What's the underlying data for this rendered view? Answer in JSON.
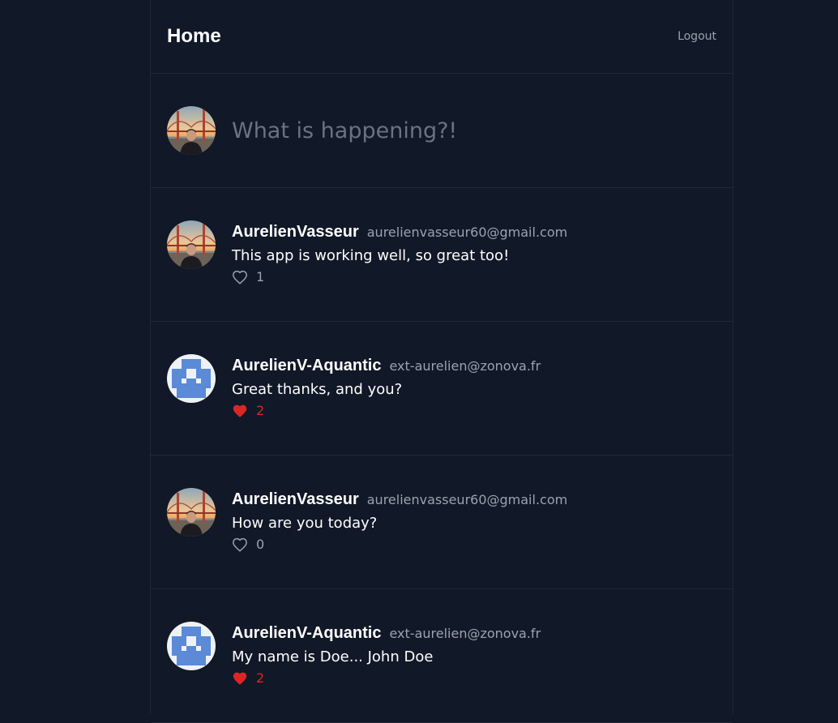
{
  "header": {
    "title": "Home",
    "logout_label": "Logout"
  },
  "compose": {
    "placeholder": "What is happening?!"
  },
  "colors": {
    "background": "#111827",
    "border": "#1f2937",
    "muted": "#9ca3af",
    "like_active": "#dc2626",
    "identicon": "#5b8ad6"
  },
  "posts": [
    {
      "username": "AurelienVasseur",
      "email": "aurelienvasseur60@gmail.com",
      "text": "This app is working well, so great too!",
      "likes": "1",
      "liked": false,
      "avatar": "photo"
    },
    {
      "username": "AurelienV-Aquantic",
      "email": "ext-aurelien@zonova.fr",
      "text": "Great thanks, and you?",
      "likes": "2",
      "liked": true,
      "avatar": "identicon"
    },
    {
      "username": "AurelienVasseur",
      "email": "aurelienvasseur60@gmail.com",
      "text": "How are you today?",
      "likes": "0",
      "liked": false,
      "avatar": "photo"
    },
    {
      "username": "AurelienV-Aquantic",
      "email": "ext-aurelien@zonova.fr",
      "text": "My name is Doe... John Doe",
      "likes": "2",
      "liked": true,
      "avatar": "identicon"
    }
  ]
}
